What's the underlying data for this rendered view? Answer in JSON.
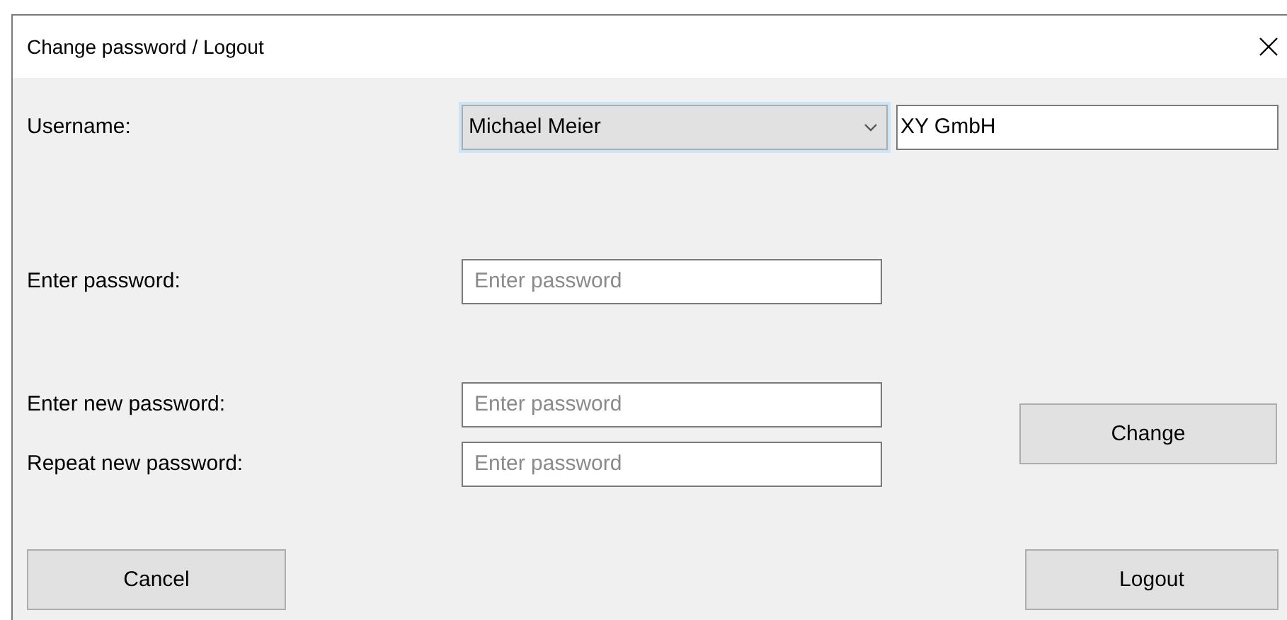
{
  "window": {
    "title": "Change password / Logout"
  },
  "username": {
    "label": "Username:",
    "value": "Michael Meier",
    "company": "XY GmbH"
  },
  "password": {
    "label": "Enter password:",
    "placeholder": "Enter password"
  },
  "new_password": {
    "label": "Enter new password:",
    "placeholder": "Enter password"
  },
  "repeat_password": {
    "label": "Repeat new password:",
    "placeholder": "Enter password"
  },
  "buttons": {
    "change": "Change",
    "cancel": "Cancel",
    "logout": "Logout"
  }
}
